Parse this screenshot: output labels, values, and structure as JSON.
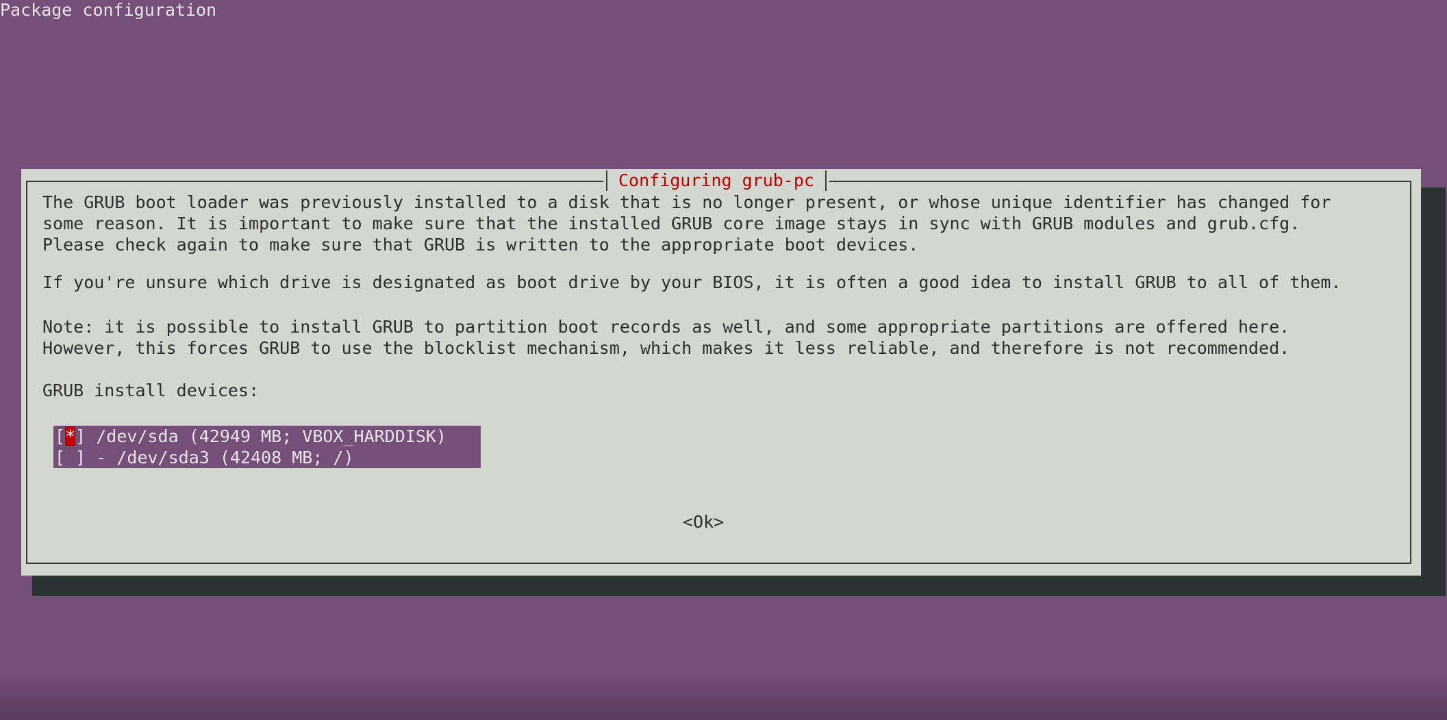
{
  "backtitle": "Package configuration",
  "dialog": {
    "title": "Configuring grub-pc",
    "paragraphs": [
      "The GRUB boot loader was previously installed to a disk that is no longer present, or whose unique identifier has changed for\nsome reason. It is important to make sure that the installed GRUB core image stays in sync with GRUB modules and grub.cfg.\nPlease check again to make sure that GRUB is written to the appropriate boot devices.",
      "If you're unsure which drive is designated as boot drive by your BIOS, it is often a good idea to install GRUB to all of them.",
      "Note: it is possible to install GRUB to partition boot records as well, and some appropriate partitions are offered here.\nHowever, this forces GRUB to use the blocklist mechanism, which makes it less reliable, and therefore is not recommended."
    ],
    "devices_label": "GRUB install devices:",
    "devices": [
      {
        "open": "[",
        "mark": "*",
        "close": "]",
        "label": " /dev/sda (42949 MB; VBOX_HARDDISK)"
      },
      {
        "open": "[",
        "mark": " ",
        "close": "]",
        "label": " - /dev/sda3 (42408 MB; /)"
      }
    ],
    "ok_label": "<Ok>"
  },
  "colors": {
    "desktop": "#744f78",
    "dialog": "#d3d7cf",
    "title": "#c00000",
    "shadow": "#2c3333"
  }
}
